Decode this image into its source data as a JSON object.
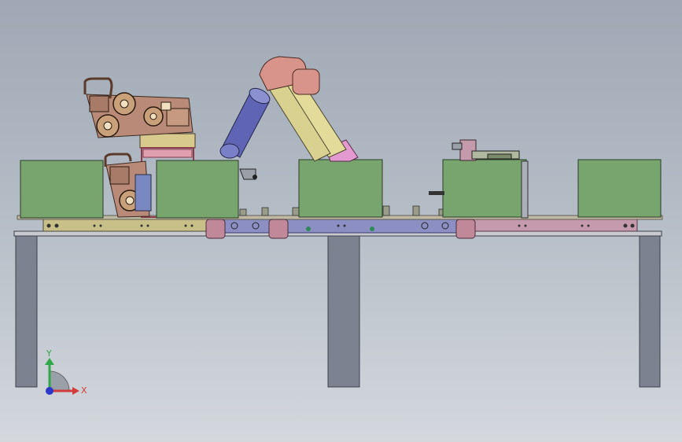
{
  "viewport": {
    "background_top": "#9fa8b4",
    "background_bottom": "#d4d8dd"
  },
  "colors": {
    "table_leg": "#7d8291",
    "table_top": "#c8cad0",
    "green_box": "#78a46e",
    "rail_olive": "#c9bf88",
    "rail_blue": "#8c8fc4",
    "rail_pink": "#c59aac",
    "robot_yellow": "#e2db9a",
    "robot_salmon": "#d8948a",
    "robot_blue": "#5f64b4",
    "robot_pink": "#e39ad0",
    "mechanism_brown": "#b98a78"
  },
  "triad": {
    "x_label": "X",
    "y_label": "Y",
    "x_color": "#d23c3c",
    "y_color": "#2fa84a",
    "z_color": "#2e38c8"
  }
}
